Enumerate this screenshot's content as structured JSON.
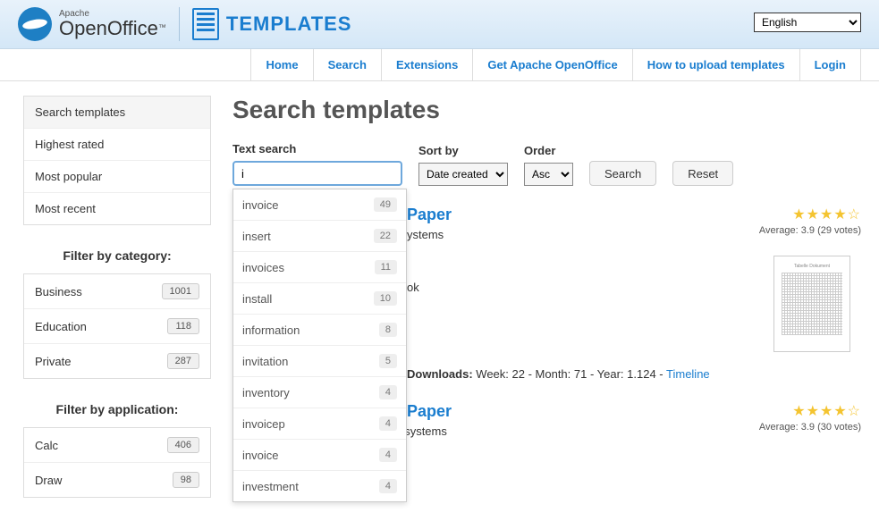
{
  "header": {
    "brand_small": "Apache",
    "brand_big": "OpenOffice",
    "brand_tm": "™",
    "templates_label": "TEMPLATES",
    "language": "English"
  },
  "nav": {
    "home": "Home",
    "search": "Search",
    "extensions": "Extensions",
    "get": "Get Apache OpenOffice",
    "howto": "How to upload templates",
    "login": "Login"
  },
  "sidebar": {
    "tabs": {
      "search": "Search templates",
      "highest": "Highest rated",
      "popular": "Most popular",
      "recent": "Most recent"
    },
    "filter_category_title": "Filter by category:",
    "categories": {
      "business": {
        "label": "Business",
        "count": "1001"
      },
      "education": {
        "label": "Education",
        "count": "118"
      },
      "private": {
        "label": "Private",
        "count": "287"
      }
    },
    "filter_app_title": "Filter by application:",
    "apps": {
      "calc": {
        "label": "Calc",
        "count": "406"
      },
      "draw": {
        "label": "Draw",
        "count": "98"
      }
    }
  },
  "page": {
    "title": "Search templates",
    "text_search_label": "Text search",
    "text_search_value": "i",
    "sort_label": "Sort by",
    "sort_value": "Date created",
    "order_label": "Order",
    "order_value": "Asc",
    "search_btn": "Search",
    "reset_btn": "Reset"
  },
  "autocomplete": [
    {
      "term": "invoice",
      "count": "49"
    },
    {
      "term": "insert",
      "count": "22"
    },
    {
      "term": "invoices",
      "count": "11"
    },
    {
      "term": "install",
      "count": "10"
    },
    {
      "term": "information",
      "count": "8"
    },
    {
      "term": "invitation",
      "count": "5"
    },
    {
      "term": "inventory",
      "count": "4"
    },
    {
      "term": "invoicep",
      "count": "4"
    },
    {
      "term": "invoice",
      "count": "4"
    },
    {
      "term": "investment",
      "count": "4"
    }
  ],
  "results": {
    "r1": {
      "title_suffix": "Paper",
      "subtitle_suffix": "ystems",
      "line_suffix": "ok",
      "downloads_label": "Downloads:",
      "downloads_text": "Week: 22 - Month: 71 - Year: 1.124 -",
      "timeline": "Timeline",
      "rating_text": "Average: 3.9 (29 votes)"
    },
    "r2": {
      "title_suffix": "Paper",
      "subtitle_prefix": "Template created by Sun Microsystems",
      "rating_text": "Average: 3.9 (30 votes)"
    }
  }
}
